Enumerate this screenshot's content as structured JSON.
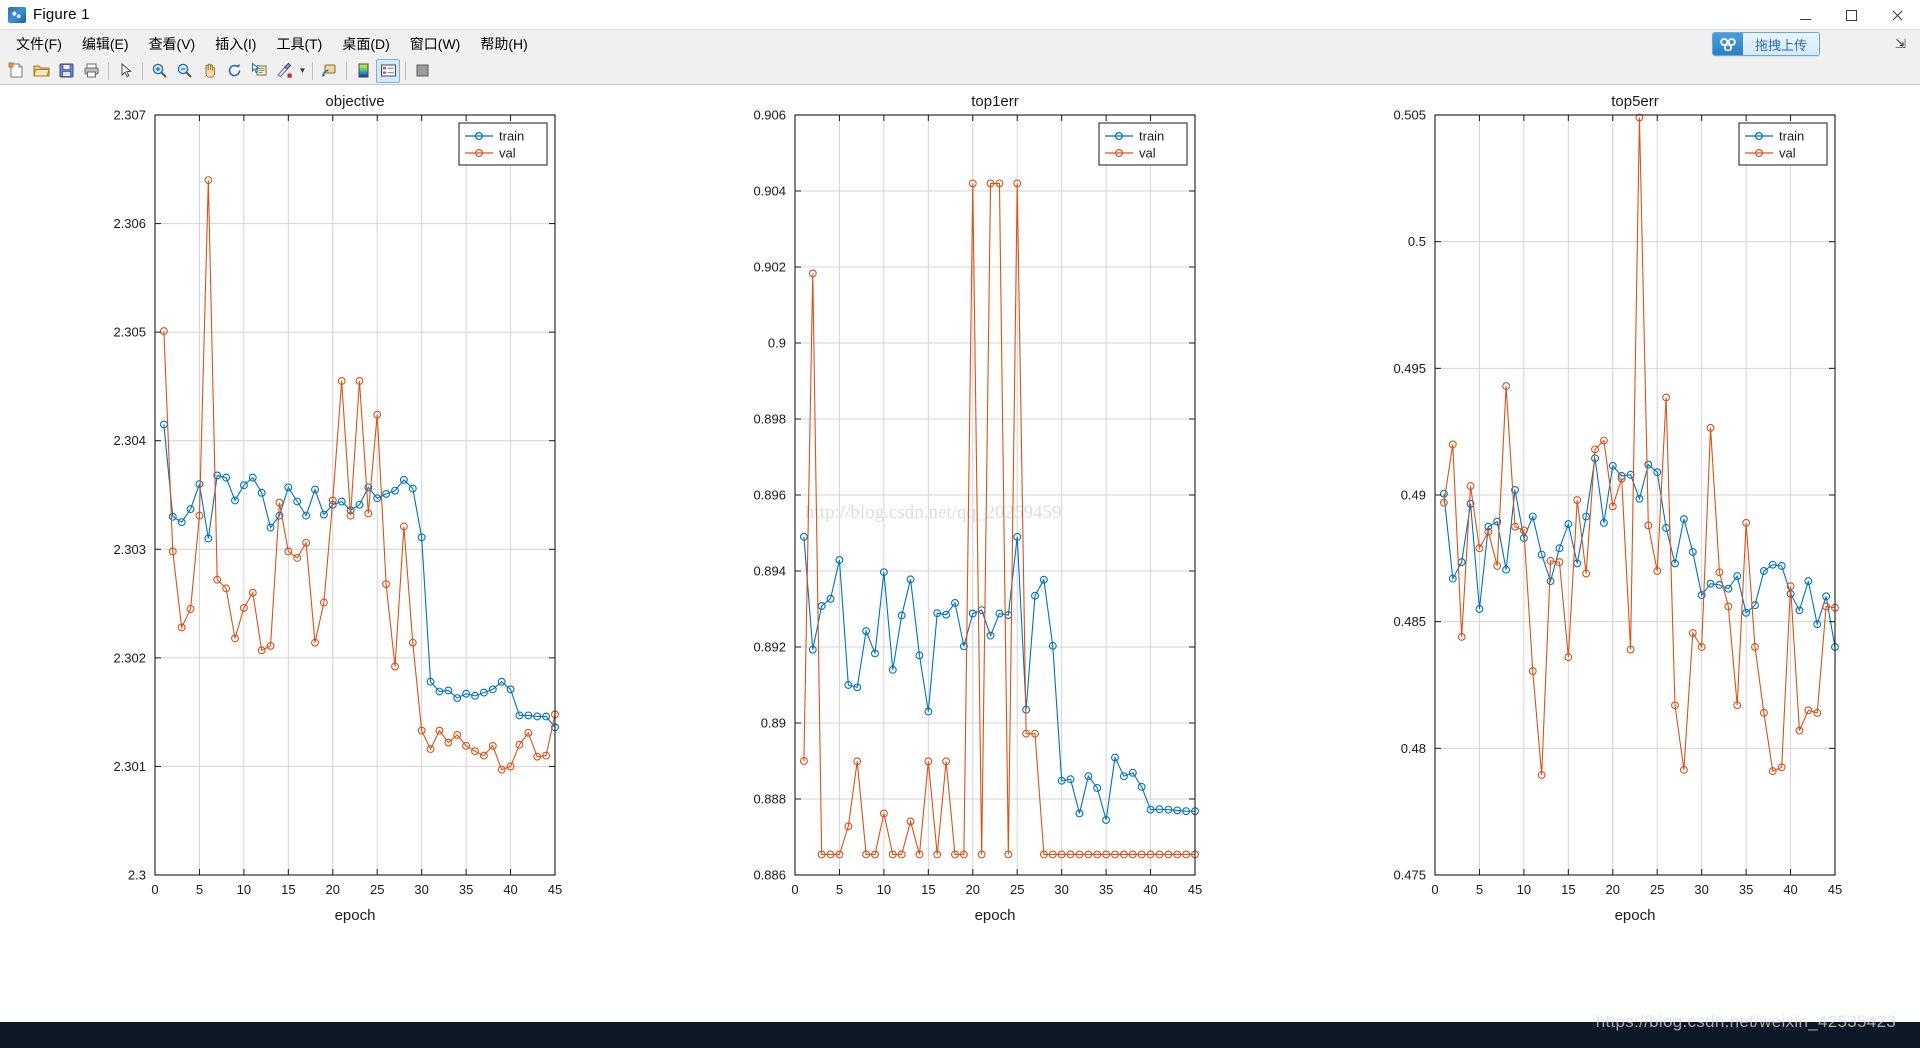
{
  "window": {
    "title": "Figure 1",
    "app_icon": "matlab-icon",
    "minimize_label": "Minimize",
    "maximize_label": "Maximize",
    "close_label": "Close"
  },
  "menubar": {
    "items": [
      {
        "label": "文件(F)",
        "name": "menu-file"
      },
      {
        "label": "编辑(E)",
        "name": "menu-edit"
      },
      {
        "label": "查看(V)",
        "name": "menu-view"
      },
      {
        "label": "插入(I)",
        "name": "menu-insert"
      },
      {
        "label": "工具(T)",
        "name": "menu-tools"
      },
      {
        "label": "桌面(D)",
        "name": "menu-desktop"
      },
      {
        "label": "窗口(W)",
        "name": "menu-window"
      },
      {
        "label": "帮助(H)",
        "name": "menu-help"
      }
    ],
    "upload_button_label": "拖拽上传",
    "collapse_arrow": "⇲"
  },
  "toolbar": {
    "buttons": [
      {
        "name": "new-figure-button",
        "tip": "New Figure"
      },
      {
        "name": "open-file-button",
        "tip": "Open File"
      },
      {
        "name": "save-figure-button",
        "tip": "Save Figure"
      },
      {
        "name": "print-figure-button",
        "tip": "Print Figure"
      },
      {
        "name": "pointer-select-button",
        "tip": "Edit Plot"
      },
      {
        "name": "zoom-in-button",
        "tip": "Zoom In"
      },
      {
        "name": "zoom-out-button",
        "tip": "Zoom Out"
      },
      {
        "name": "pan-button",
        "tip": "Pan"
      },
      {
        "name": "rotate-3d-button",
        "tip": "Rotate 3D"
      },
      {
        "name": "data-cursor-button",
        "tip": "Data Cursor"
      },
      {
        "name": "brush-button",
        "tip": "Brush/Select Data"
      },
      {
        "name": "link-plot-button",
        "tip": "Link Plot"
      },
      {
        "name": "colorbar-button",
        "tip": "Insert Colorbar"
      },
      {
        "name": "legend-button",
        "tip": "Insert Legend"
      },
      {
        "name": "plot-browser-button",
        "tip": "Hide Plot Tools"
      }
    ]
  },
  "figure": {
    "watermark_center": "http://blog.csdn.net/qq_20259459",
    "watermark_bottom": "https://blog.csdn.net/weixin_42535423",
    "series_colors": {
      "train": "#0072BD",
      "val": "#D95319"
    }
  },
  "chart_data": [
    {
      "type": "line",
      "title": "objective",
      "xlabel": "epoch",
      "ylabel": "",
      "xlim": [
        0,
        45
      ],
      "ylim": [
        2.3,
        2.307
      ],
      "xticks": [
        0,
        5,
        10,
        15,
        20,
        25,
        30,
        35,
        40,
        45
      ],
      "yticks": [
        2.3,
        2.301,
        2.302,
        2.303,
        2.304,
        2.305,
        2.306,
        2.307
      ],
      "grid": true,
      "legend": [
        "train",
        "val"
      ],
      "legend_position": "top-right",
      "x": [
        1,
        2,
        3,
        4,
        5,
        6,
        7,
        8,
        9,
        10,
        11,
        12,
        13,
        14,
        15,
        16,
        17,
        18,
        19,
        20,
        21,
        22,
        23,
        24,
        25,
        26,
        27,
        28,
        29,
        30,
        31,
        32,
        33,
        34,
        35,
        36,
        37,
        38,
        39,
        40,
        41,
        42,
        43,
        44,
        45
      ],
      "series": [
        {
          "name": "train",
          "values": [
            2.30415,
            2.3033,
            2.30325,
            2.30337,
            2.3036,
            2.3031,
            2.30368,
            2.30366,
            2.30345,
            2.30359,
            2.30366,
            2.30352,
            2.3032,
            2.30331,
            2.30357,
            2.30344,
            2.30331,
            2.30355,
            2.30332,
            2.30341,
            2.30344,
            2.30336,
            2.30341,
            2.30357,
            2.30347,
            2.30351,
            2.30354,
            2.30364,
            2.30356,
            2.30311,
            2.30178,
            2.30169,
            2.3017,
            2.30163,
            2.30167,
            2.30165,
            2.30168,
            2.30171,
            2.30178,
            2.30171,
            2.30147,
            2.30147,
            2.30146,
            2.30146,
            2.30136
          ]
        },
        {
          "name": "val",
          "values": [
            2.30501,
            2.30298,
            2.30228,
            2.30245,
            2.30331,
            2.3064,
            2.30272,
            2.30264,
            2.30218,
            2.30246,
            2.3026,
            2.30207,
            2.30211,
            2.30343,
            2.30298,
            2.30292,
            2.30306,
            2.30214,
            2.30251,
            2.30345,
            2.30455,
            2.30331,
            2.30455,
            2.30333,
            2.30424,
            2.30268,
            2.30192,
            2.30321,
            2.30214,
            2.30133,
            2.30116,
            2.30133,
            2.30122,
            2.30129,
            2.30119,
            2.30114,
            2.3011,
            2.30119,
            2.30097,
            2.301,
            2.3012,
            2.30131,
            2.30109,
            2.3011,
            2.30148
          ]
        }
      ]
    },
    {
      "type": "line",
      "title": "top1err",
      "xlabel": "epoch",
      "ylabel": "",
      "xlim": [
        0,
        45
      ],
      "ylim": [
        0.886,
        0.906
      ],
      "xticks": [
        0,
        5,
        10,
        15,
        20,
        25,
        30,
        35,
        40,
        45
      ],
      "yticks": [
        0.886,
        0.888,
        0.89,
        0.892,
        0.894,
        0.896,
        0.898,
        0.9,
        0.902,
        0.904,
        0.906
      ],
      "grid": true,
      "legend": [
        "train",
        "val"
      ],
      "legend_position": "top-right",
      "x": [
        1,
        2,
        3,
        4,
        5,
        6,
        7,
        8,
        9,
        10,
        11,
        12,
        13,
        14,
        15,
        16,
        17,
        18,
        19,
        20,
        21,
        22,
        23,
        24,
        25,
        26,
        27,
        28,
        29,
        30,
        31,
        32,
        33,
        34,
        35,
        36,
        37,
        38,
        39,
        40,
        41,
        42,
        43,
        44,
        45
      ],
      "series": [
        {
          "name": "train",
          "values": [
            0.8949,
            0.89193,
            0.89308,
            0.89327,
            0.89429,
            0.891,
            0.89094,
            0.89242,
            0.89183,
            0.89397,
            0.8914,
            0.89283,
            0.89378,
            0.89178,
            0.8903,
            0.89289,
            0.89285,
            0.89316,
            0.89202,
            0.89288,
            0.89297,
            0.8923,
            0.89288,
            0.89284,
            0.8949,
            0.89035,
            0.89335,
            0.89377,
            0.89203,
            0.88848,
            0.88852,
            0.88762,
            0.8886,
            0.88829,
            0.88745,
            0.88909,
            0.8886,
            0.88869,
            0.88832,
            0.88772,
            0.88773,
            0.88772,
            0.8877,
            0.88768,
            0.88768
          ]
        },
        {
          "name": "val",
          "values": [
            0.889,
            0.90183,
            0.88654,
            0.88654,
            0.88654,
            0.88728,
            0.88899,
            0.88654,
            0.88654,
            0.88762,
            0.88654,
            0.88654,
            0.88741,
            0.88654,
            0.88899,
            0.88654,
            0.88899,
            0.88654,
            0.88654,
            0.9042,
            0.88654,
            0.9042,
            0.9042,
            0.88654,
            0.9042,
            0.88972,
            0.88972,
            0.88654,
            0.88654,
            0.88654,
            0.88654,
            0.88654,
            0.88654,
            0.88654,
            0.88654,
            0.88654,
            0.88654,
            0.88654,
            0.88654,
            0.88654,
            0.88654,
            0.88654,
            0.88654,
            0.88654,
            0.88654
          ]
        }
      ]
    },
    {
      "type": "line",
      "title": "top5err",
      "xlabel": "epoch",
      "ylabel": "",
      "xlim": [
        0,
        45
      ],
      "ylim": [
        0.475,
        0.505
      ],
      "xticks": [
        0,
        5,
        10,
        15,
        20,
        25,
        30,
        35,
        40,
        45
      ],
      "yticks": [
        0.475,
        0.48,
        0.485,
        0.49,
        0.495,
        0.5,
        0.505
      ],
      "grid": true,
      "legend": [
        "train",
        "val"
      ],
      "legend_position": "top-right",
      "x": [
        1,
        2,
        3,
        4,
        5,
        6,
        7,
        8,
        9,
        10,
        11,
        12,
        13,
        14,
        15,
        16,
        17,
        18,
        19,
        20,
        21,
        22,
        23,
        24,
        25,
        26,
        27,
        28,
        29,
        30,
        31,
        32,
        33,
        34,
        35,
        36,
        37,
        38,
        39,
        40,
        41,
        42,
        43,
        44,
        45
      ],
      "series": [
        {
          "name": "train",
          "values": [
            0.49005,
            0.4867,
            0.48735,
            0.48965,
            0.4855,
            0.48875,
            0.48895,
            0.48705,
            0.4902,
            0.4883,
            0.48915,
            0.48765,
            0.4866,
            0.4879,
            0.48885,
            0.4873,
            0.48915,
            0.49145,
            0.4889,
            0.49115,
            0.49075,
            0.4908,
            0.48985,
            0.4912,
            0.4909,
            0.4887,
            0.4873,
            0.48905,
            0.48775,
            0.48605,
            0.4865,
            0.48645,
            0.4863,
            0.4868,
            0.48535,
            0.48565,
            0.487,
            0.48725,
            0.4872,
            0.4861,
            0.48545,
            0.4866,
            0.4849,
            0.486,
            0.484
          ]
        },
        {
          "name": "val",
          "values": [
            0.4897,
            0.492,
            0.4844,
            0.49035,
            0.4879,
            0.48855,
            0.4872,
            0.4943,
            0.48875,
            0.4886,
            0.48305,
            0.47895,
            0.4874,
            0.48735,
            0.4836,
            0.4898,
            0.4869,
            0.4918,
            0.49215,
            0.48955,
            0.49065,
            0.4839,
            0.5049,
            0.4888,
            0.487,
            0.49385,
            0.4817,
            0.47915,
            0.48455,
            0.484,
            0.49265,
            0.48695,
            0.4856,
            0.4817,
            0.4889,
            0.484,
            0.4814,
            0.4791,
            0.47925,
            0.4864,
            0.4807,
            0.4815,
            0.4814,
            0.4856,
            0.48555
          ]
        }
      ]
    }
  ]
}
